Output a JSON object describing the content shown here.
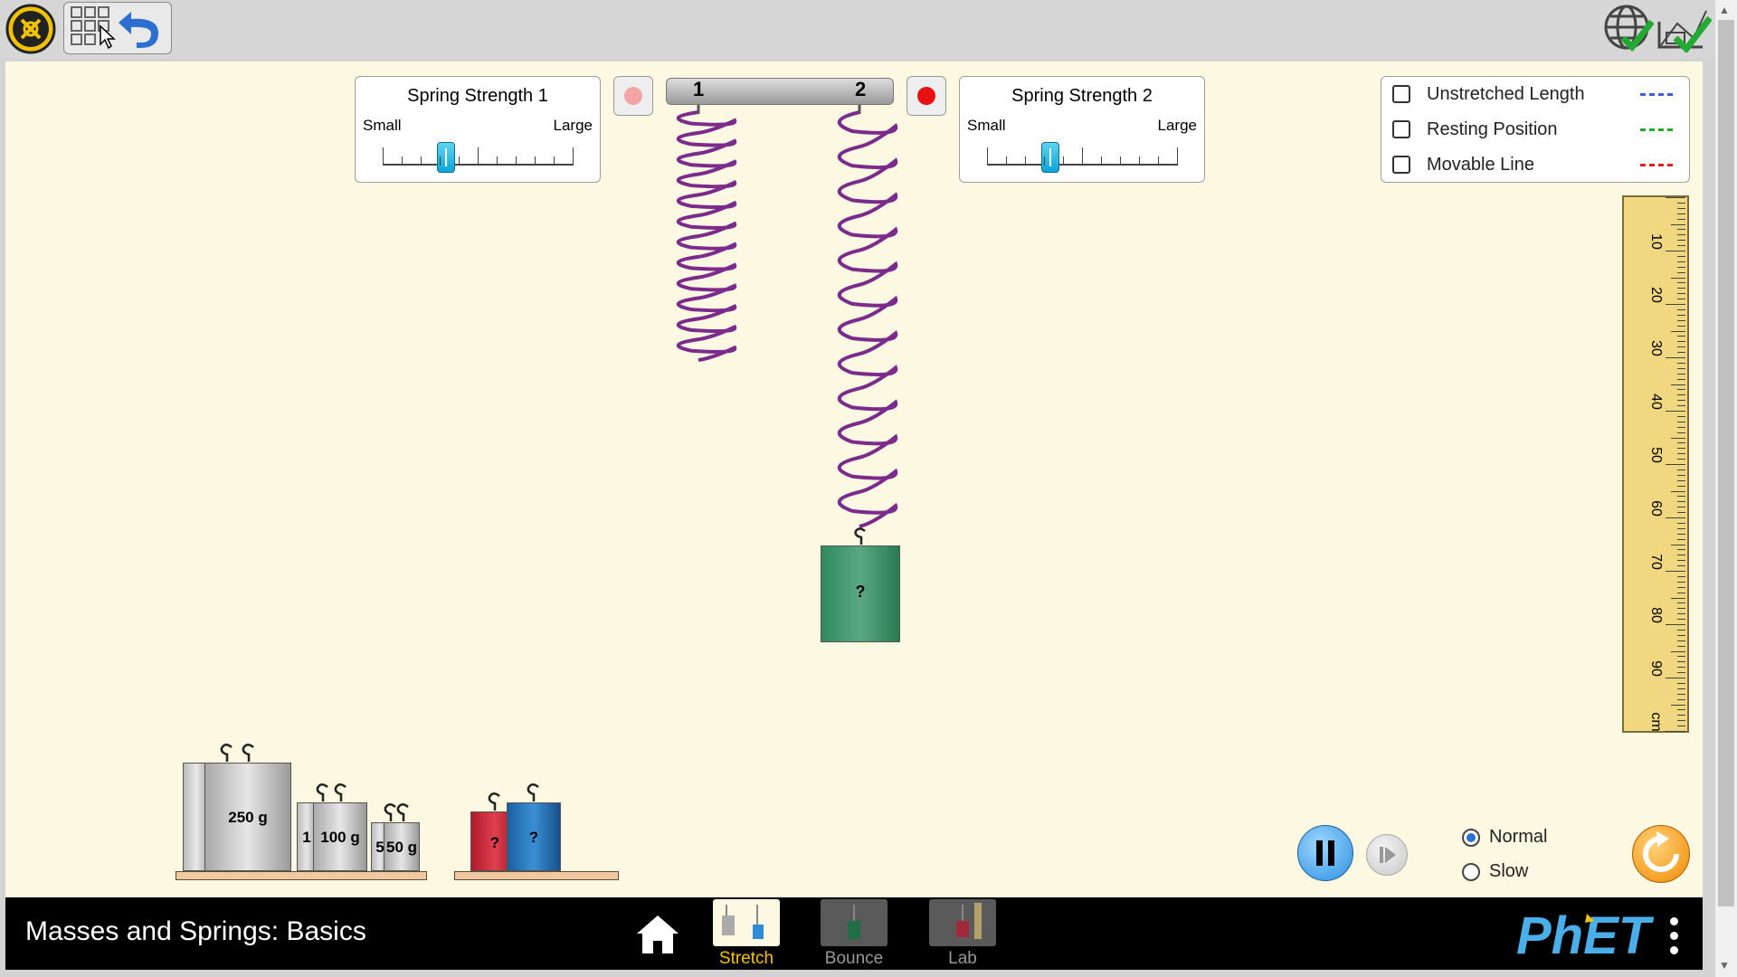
{
  "spring_panel_1": {
    "title": "Spring Strength 1",
    "small": "Small",
    "large": "Large",
    "value": 0.33
  },
  "spring_panel_2": {
    "title": "Spring Strength 2",
    "small": "Small",
    "large": "Large",
    "value": 0.33
  },
  "hanger": {
    "label_1": "1",
    "label_2": "2"
  },
  "checkboxes": [
    {
      "label": "Unstretched Length",
      "color": "#3a5fd8",
      "checked": false
    },
    {
      "label": "Resting Position",
      "color": "#22aa22",
      "checked": false
    },
    {
      "label": "Movable Line",
      "color": "#e02020",
      "checked": false
    }
  ],
  "ruler": {
    "labels": [
      "10",
      "20",
      "30",
      "40",
      "50",
      "60",
      "70",
      "80",
      "90",
      "cm"
    ]
  },
  "hanging_mass": {
    "label": "?"
  },
  "masses": {
    "big": "250 g",
    "mid": "100 g",
    "mid_prefix": "1",
    "small": "50 g",
    "small_prefix": "5",
    "hook": "?",
    "red": "?",
    "blue": "?"
  },
  "speed": {
    "normal": "Normal",
    "slow": "Slow",
    "selected": "Normal"
  },
  "footer": {
    "title": "Masses and Springs: Basics",
    "screens": [
      {
        "label": "Stretch",
        "selected": true
      },
      {
        "label": "Bounce",
        "selected": false
      },
      {
        "label": "Lab",
        "selected": false
      }
    ],
    "brand": "PhET"
  },
  "colors": {
    "spring": "#7a2b8c",
    "accent": "#f5a623",
    "selected_tab": "#f5c400"
  }
}
